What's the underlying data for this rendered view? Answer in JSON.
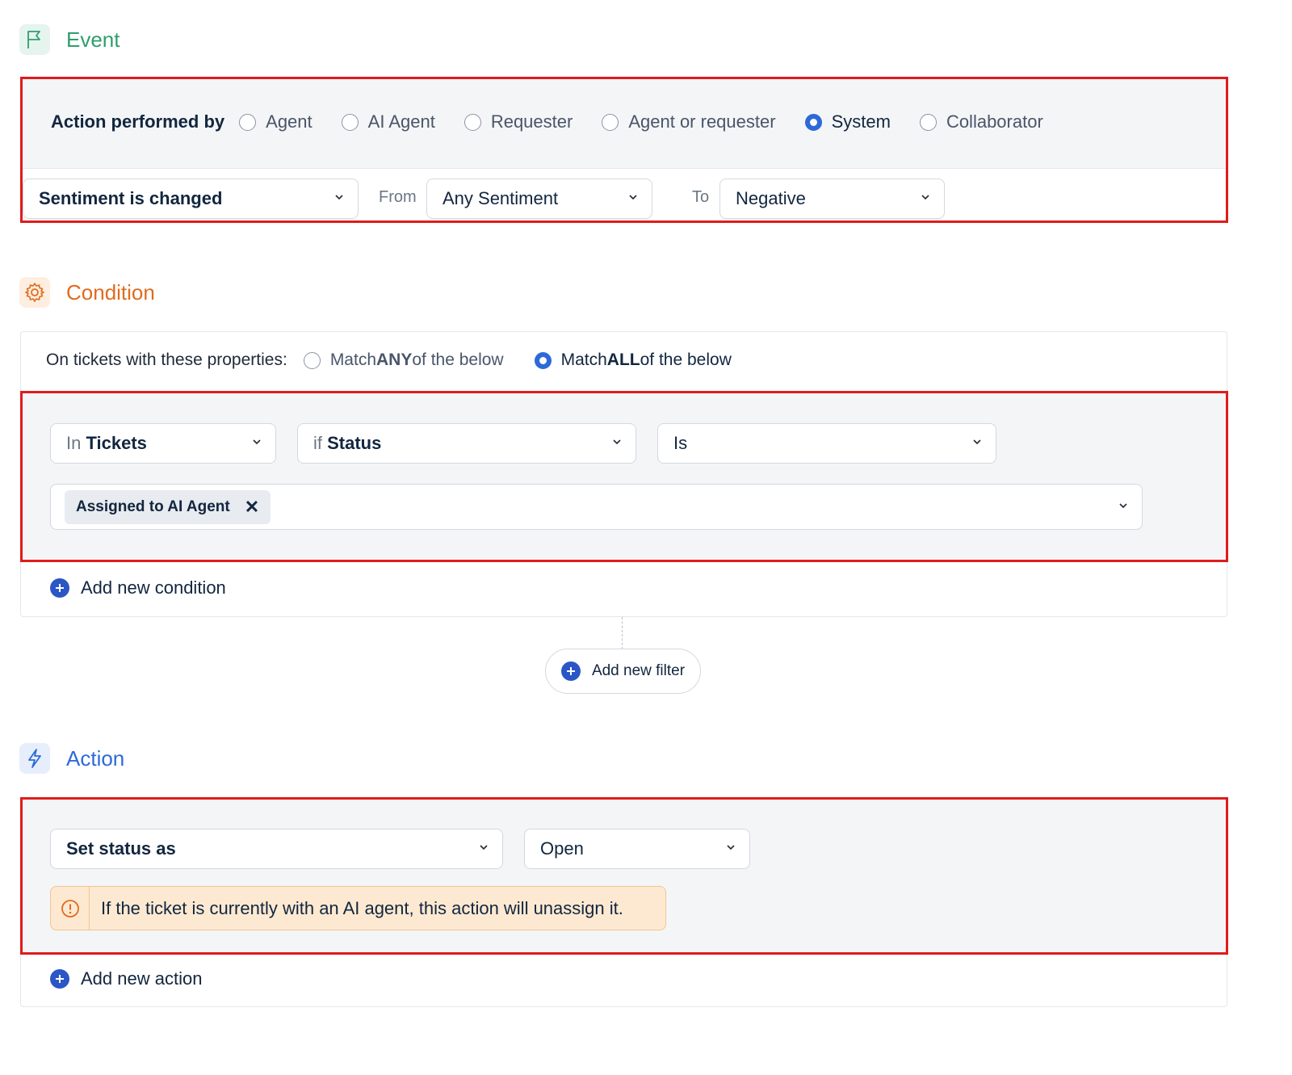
{
  "event": {
    "title": "Event",
    "icon": "flag-icon",
    "performed_by_label": "Action performed by",
    "performers": [
      {
        "label": "Agent",
        "checked": false
      },
      {
        "label": "AI Agent",
        "checked": false
      },
      {
        "label": "Requester",
        "checked": false
      },
      {
        "label": "Agent or requester",
        "checked": false
      },
      {
        "label": "System",
        "checked": true
      },
      {
        "label": "Collaborator",
        "checked": false
      }
    ],
    "trigger_select": "Sentiment is changed",
    "from_label": "From",
    "from_select": "Any Sentiment",
    "to_label": "To",
    "to_select": "Negative"
  },
  "condition": {
    "title": "Condition",
    "icon": "gear-icon",
    "properties_label": "On tickets with these properties:",
    "match_any": {
      "prefix": "Match ",
      "bold": "ANY",
      "suffix": " of the below",
      "checked": false
    },
    "match_all": {
      "prefix": "Match ",
      "bold": "ALL",
      "suffix": " of the below",
      "checked": true
    },
    "in_select": {
      "prefix": "In ",
      "value": "Tickets"
    },
    "field_select": {
      "prefix": "if ",
      "value": "Status"
    },
    "operator_select": "Is",
    "value_chip": "Assigned to AI Agent",
    "add_condition": "Add new condition",
    "add_filter": "Add new filter"
  },
  "action": {
    "title": "Action",
    "icon": "lightning-icon",
    "action_select": "Set status as",
    "value_select": "Open",
    "warning": "If the ticket is currently with an AI agent, this action will unassign it.",
    "add_action": "Add new action"
  },
  "colors": {
    "highlight": "#e01b1b",
    "accent": "#2d6ad8",
    "event": "#2f9e6e",
    "condition": "#e06b1f",
    "warning_bg": "#fde9d1"
  }
}
